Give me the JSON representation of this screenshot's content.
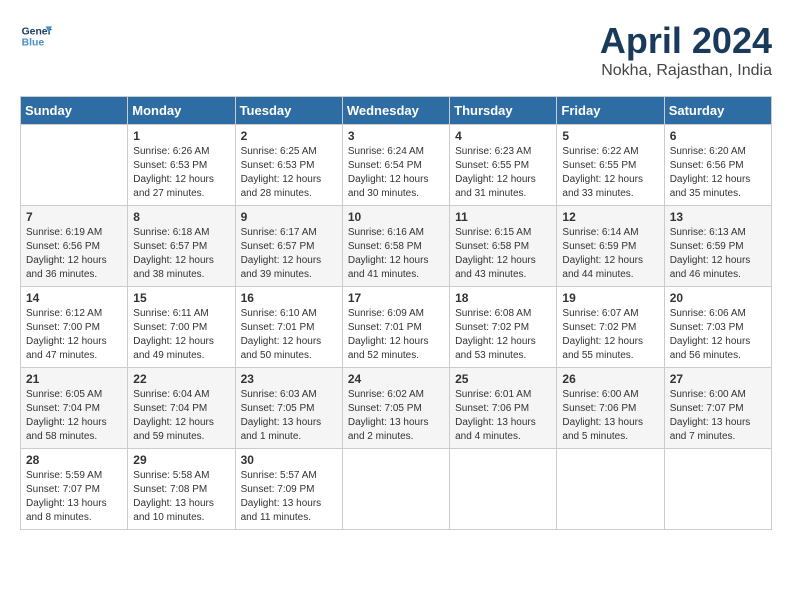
{
  "logo": {
    "line1": "General",
    "line2": "Blue"
  },
  "title": "April 2024",
  "subtitle": "Nokha, Rajasthan, India",
  "weekdays": [
    "Sunday",
    "Monday",
    "Tuesday",
    "Wednesday",
    "Thursday",
    "Friday",
    "Saturday"
  ],
  "weeks": [
    [
      {
        "day": "",
        "sunrise": "",
        "sunset": "",
        "daylight": ""
      },
      {
        "day": "1",
        "sunrise": "Sunrise: 6:26 AM",
        "sunset": "Sunset: 6:53 PM",
        "daylight": "Daylight: 12 hours and 27 minutes."
      },
      {
        "day": "2",
        "sunrise": "Sunrise: 6:25 AM",
        "sunset": "Sunset: 6:53 PM",
        "daylight": "Daylight: 12 hours and 28 minutes."
      },
      {
        "day": "3",
        "sunrise": "Sunrise: 6:24 AM",
        "sunset": "Sunset: 6:54 PM",
        "daylight": "Daylight: 12 hours and 30 minutes."
      },
      {
        "day": "4",
        "sunrise": "Sunrise: 6:23 AM",
        "sunset": "Sunset: 6:55 PM",
        "daylight": "Daylight: 12 hours and 31 minutes."
      },
      {
        "day": "5",
        "sunrise": "Sunrise: 6:22 AM",
        "sunset": "Sunset: 6:55 PM",
        "daylight": "Daylight: 12 hours and 33 minutes."
      },
      {
        "day": "6",
        "sunrise": "Sunrise: 6:20 AM",
        "sunset": "Sunset: 6:56 PM",
        "daylight": "Daylight: 12 hours and 35 minutes."
      }
    ],
    [
      {
        "day": "7",
        "sunrise": "Sunrise: 6:19 AM",
        "sunset": "Sunset: 6:56 PM",
        "daylight": "Daylight: 12 hours and 36 minutes."
      },
      {
        "day": "8",
        "sunrise": "Sunrise: 6:18 AM",
        "sunset": "Sunset: 6:57 PM",
        "daylight": "Daylight: 12 hours and 38 minutes."
      },
      {
        "day": "9",
        "sunrise": "Sunrise: 6:17 AM",
        "sunset": "Sunset: 6:57 PM",
        "daylight": "Daylight: 12 hours and 39 minutes."
      },
      {
        "day": "10",
        "sunrise": "Sunrise: 6:16 AM",
        "sunset": "Sunset: 6:58 PM",
        "daylight": "Daylight: 12 hours and 41 minutes."
      },
      {
        "day": "11",
        "sunrise": "Sunrise: 6:15 AM",
        "sunset": "Sunset: 6:58 PM",
        "daylight": "Daylight: 12 hours and 43 minutes."
      },
      {
        "day": "12",
        "sunrise": "Sunrise: 6:14 AM",
        "sunset": "Sunset: 6:59 PM",
        "daylight": "Daylight: 12 hours and 44 minutes."
      },
      {
        "day": "13",
        "sunrise": "Sunrise: 6:13 AM",
        "sunset": "Sunset: 6:59 PM",
        "daylight": "Daylight: 12 hours and 46 minutes."
      }
    ],
    [
      {
        "day": "14",
        "sunrise": "Sunrise: 6:12 AM",
        "sunset": "Sunset: 7:00 PM",
        "daylight": "Daylight: 12 hours and 47 minutes."
      },
      {
        "day": "15",
        "sunrise": "Sunrise: 6:11 AM",
        "sunset": "Sunset: 7:00 PM",
        "daylight": "Daylight: 12 hours and 49 minutes."
      },
      {
        "day": "16",
        "sunrise": "Sunrise: 6:10 AM",
        "sunset": "Sunset: 7:01 PM",
        "daylight": "Daylight: 12 hours and 50 minutes."
      },
      {
        "day": "17",
        "sunrise": "Sunrise: 6:09 AM",
        "sunset": "Sunset: 7:01 PM",
        "daylight": "Daylight: 12 hours and 52 minutes."
      },
      {
        "day": "18",
        "sunrise": "Sunrise: 6:08 AM",
        "sunset": "Sunset: 7:02 PM",
        "daylight": "Daylight: 12 hours and 53 minutes."
      },
      {
        "day": "19",
        "sunrise": "Sunrise: 6:07 AM",
        "sunset": "Sunset: 7:02 PM",
        "daylight": "Daylight: 12 hours and 55 minutes."
      },
      {
        "day": "20",
        "sunrise": "Sunrise: 6:06 AM",
        "sunset": "Sunset: 7:03 PM",
        "daylight": "Daylight: 12 hours and 56 minutes."
      }
    ],
    [
      {
        "day": "21",
        "sunrise": "Sunrise: 6:05 AM",
        "sunset": "Sunset: 7:04 PM",
        "daylight": "Daylight: 12 hours and 58 minutes."
      },
      {
        "day": "22",
        "sunrise": "Sunrise: 6:04 AM",
        "sunset": "Sunset: 7:04 PM",
        "daylight": "Daylight: 12 hours and 59 minutes."
      },
      {
        "day": "23",
        "sunrise": "Sunrise: 6:03 AM",
        "sunset": "Sunset: 7:05 PM",
        "daylight": "Daylight: 13 hours and 1 minute."
      },
      {
        "day": "24",
        "sunrise": "Sunrise: 6:02 AM",
        "sunset": "Sunset: 7:05 PM",
        "daylight": "Daylight: 13 hours and 2 minutes."
      },
      {
        "day": "25",
        "sunrise": "Sunrise: 6:01 AM",
        "sunset": "Sunset: 7:06 PM",
        "daylight": "Daylight: 13 hours and 4 minutes."
      },
      {
        "day": "26",
        "sunrise": "Sunrise: 6:00 AM",
        "sunset": "Sunset: 7:06 PM",
        "daylight": "Daylight: 13 hours and 5 minutes."
      },
      {
        "day": "27",
        "sunrise": "Sunrise: 6:00 AM",
        "sunset": "Sunset: 7:07 PM",
        "daylight": "Daylight: 13 hours and 7 minutes."
      }
    ],
    [
      {
        "day": "28",
        "sunrise": "Sunrise: 5:59 AM",
        "sunset": "Sunset: 7:07 PM",
        "daylight": "Daylight: 13 hours and 8 minutes."
      },
      {
        "day": "29",
        "sunrise": "Sunrise: 5:58 AM",
        "sunset": "Sunset: 7:08 PM",
        "daylight": "Daylight: 13 hours and 10 minutes."
      },
      {
        "day": "30",
        "sunrise": "Sunrise: 5:57 AM",
        "sunset": "Sunset: 7:09 PM",
        "daylight": "Daylight: 13 hours and 11 minutes."
      },
      {
        "day": "",
        "sunrise": "",
        "sunset": "",
        "daylight": ""
      },
      {
        "day": "",
        "sunrise": "",
        "sunset": "",
        "daylight": ""
      },
      {
        "day": "",
        "sunrise": "",
        "sunset": "",
        "daylight": ""
      },
      {
        "day": "",
        "sunrise": "",
        "sunset": "",
        "daylight": ""
      }
    ]
  ]
}
